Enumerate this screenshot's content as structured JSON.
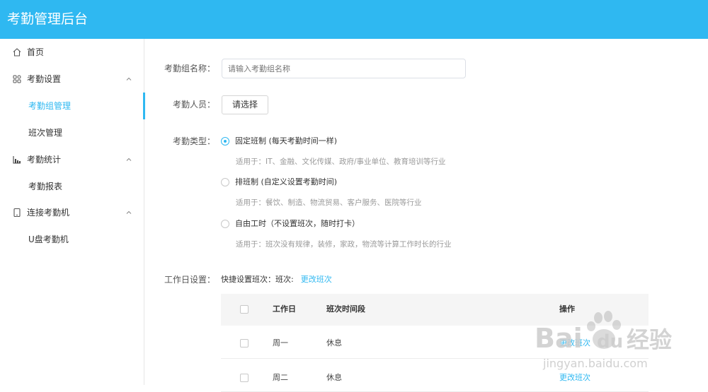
{
  "app": {
    "title": "考勤管理后台"
  },
  "sidebar": {
    "items": [
      {
        "label": "首页",
        "icon": "home-icon"
      },
      {
        "label": "考勤设置",
        "icon": "grid-icon"
      },
      {
        "label": "考勤组管理"
      },
      {
        "label": "班次管理"
      },
      {
        "label": "考勤统计",
        "icon": "bar-chart-icon"
      },
      {
        "label": "考勤报表"
      },
      {
        "label": "连接考勤机",
        "icon": "device-icon"
      },
      {
        "label": "U盘考勤机"
      }
    ]
  },
  "form": {
    "group_name_label": "考勤组名称：",
    "group_name_placeholder": "请输入考勤组名称",
    "members_label": "考勤人员：",
    "members_button": "请选择",
    "type_label": "考勤类型：",
    "types": [
      {
        "label": "固定班制 (每天考勤时间一样)",
        "hint": "适用于：IT、金融、文化传媒、政府/事业单位、教育培训等行业",
        "checked": true
      },
      {
        "label": "排班制 (自定义设置考勤时间)",
        "hint": "适用于：餐饮、制造、物流贸易、客户服务、医院等行业",
        "checked": false
      },
      {
        "label": "自由工时（不设置班次，随时打卡）",
        "hint": "适用于：班次没有规律，装修，家政，物流等计算工作时长的行业",
        "checked": false
      }
    ],
    "workday_label": "工作日设置：",
    "quick_text": "快捷设置班次：班次:",
    "quick_link": "更改班次"
  },
  "table": {
    "headers": {
      "day": "工作日",
      "period": "班次时间段",
      "action": "操作"
    },
    "rows": [
      {
        "day": "周一",
        "period": "休息",
        "action": "更改班次"
      },
      {
        "day": "周二",
        "period": "休息",
        "action": "更改班次"
      }
    ]
  },
  "watermark": {
    "brand": "Bai",
    "brand2": "du",
    "cn": "经验",
    "url": "jingyan.baidu.com"
  },
  "colors": {
    "accent": "#2fb8f1",
    "header_bg": "#2fb8f1"
  }
}
